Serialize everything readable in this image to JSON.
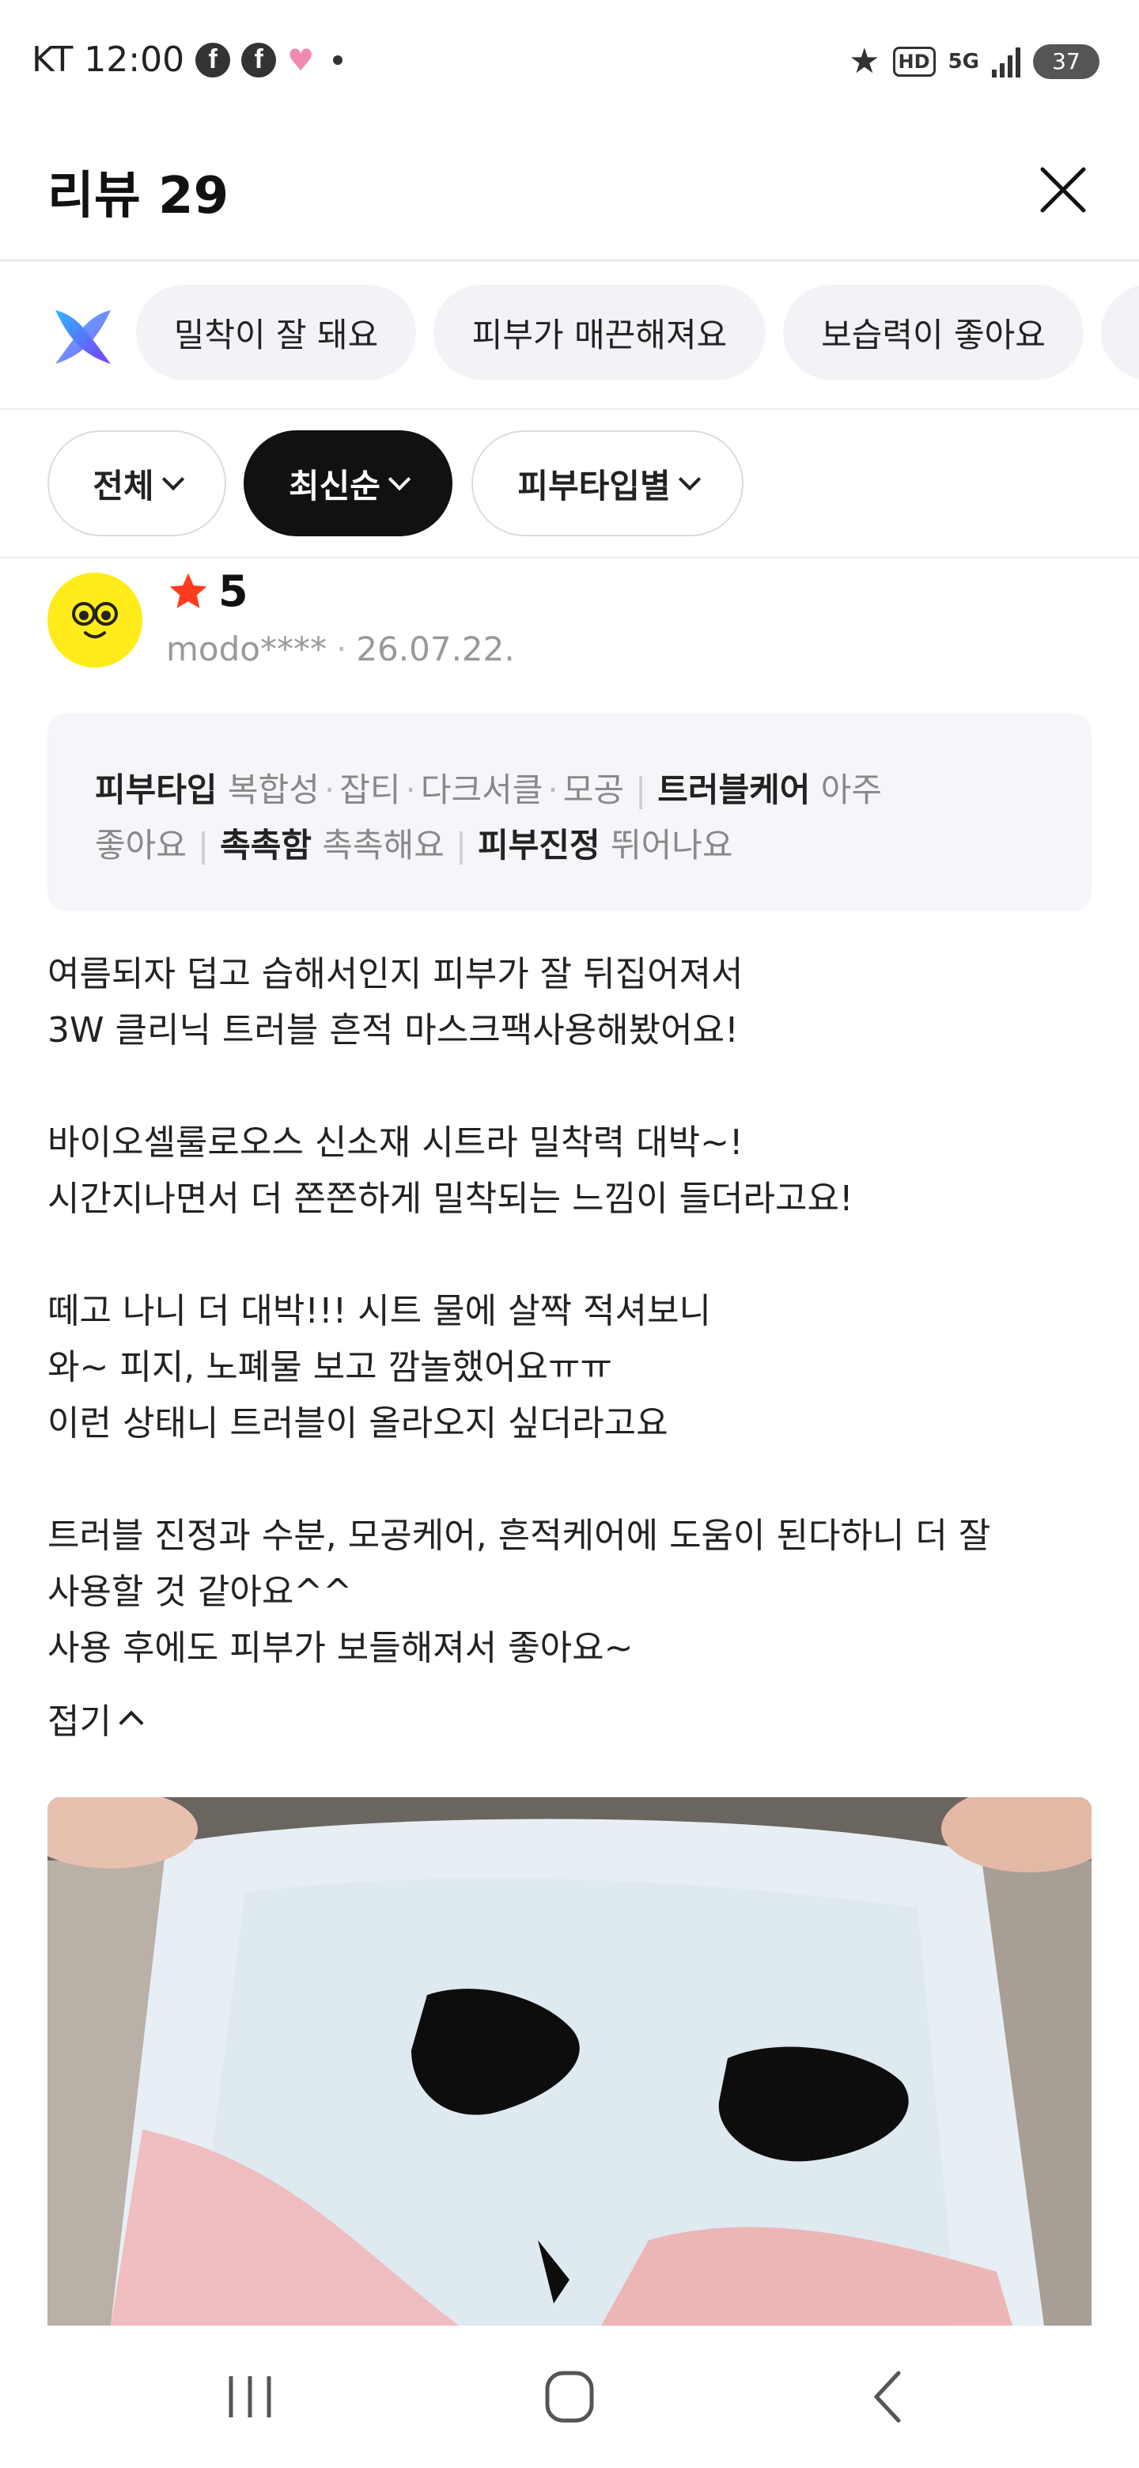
{
  "status_bar": {
    "carrier_time": "KT 12:00",
    "app_icons": [
      "facebook-icon",
      "facebook-icon",
      "heart-icon",
      "dot-icon"
    ],
    "hd_label": "HD",
    "network_label": "5G",
    "battery": "37"
  },
  "header": {
    "title": "리뷰 29"
  },
  "keywords": {
    "chips": [
      "밀착이 잘 돼요",
      "피부가 매끈해져요",
      "보습력이 좋아요"
    ]
  },
  "filters": {
    "items": [
      {
        "label": "전체",
        "active": false
      },
      {
        "label": "최신순",
        "active": true
      },
      {
        "label": "피부타입별",
        "active": false
      }
    ]
  },
  "review": {
    "rating": "5",
    "user": "modo****",
    "date": "26.07.22.",
    "attributes": {
      "skin_type_label": "피부타입",
      "skin_types": [
        "복합성",
        "잡티",
        "다크서클",
        "모공"
      ],
      "trouble_label": "트러블케어",
      "trouble_value_1": "아주",
      "trouble_value_2": "좋아요",
      "moisture_label": "촉촉함",
      "moisture_value": "촉촉해요",
      "soothing_label": "피부진정",
      "soothing_value": "뛰어나요"
    },
    "body_lines": [
      "여름되자 덥고 습해서인지 피부가 잘 뒤집어져서",
      "3W 클리닉 트러블 흔적 마스크팩사용해봤어요!",
      "",
      "바이오셀룰로오스 신소재 시트라 밀착력 대박~!",
      "시간지나면서 더 쫀쫀하게 밀착되는 느낌이 들더라고요!",
      "",
      "떼고 나니 더 대박!!! 시트 물에 살짝 적셔보니",
      "와~ 피지, 노폐물 보고 깜놀했어요ㅠㅠ",
      "이런 상태니 트러블이 올라오지 싶더라고요",
      "",
      "트러블 진정과 수분, 모공케어, 흔적케어에 도움이 된다하니 더 잘",
      "사용할 것 같아요^^",
      "사용 후에도 피부가 보들해져서 좋아요~"
    ],
    "collapse_label": "접기"
  },
  "colors": {
    "star": "#ff3b1f",
    "avatar_bg": "#ffec1a",
    "active_filter": "#111111",
    "chip_bg": "#f1f3f6"
  }
}
